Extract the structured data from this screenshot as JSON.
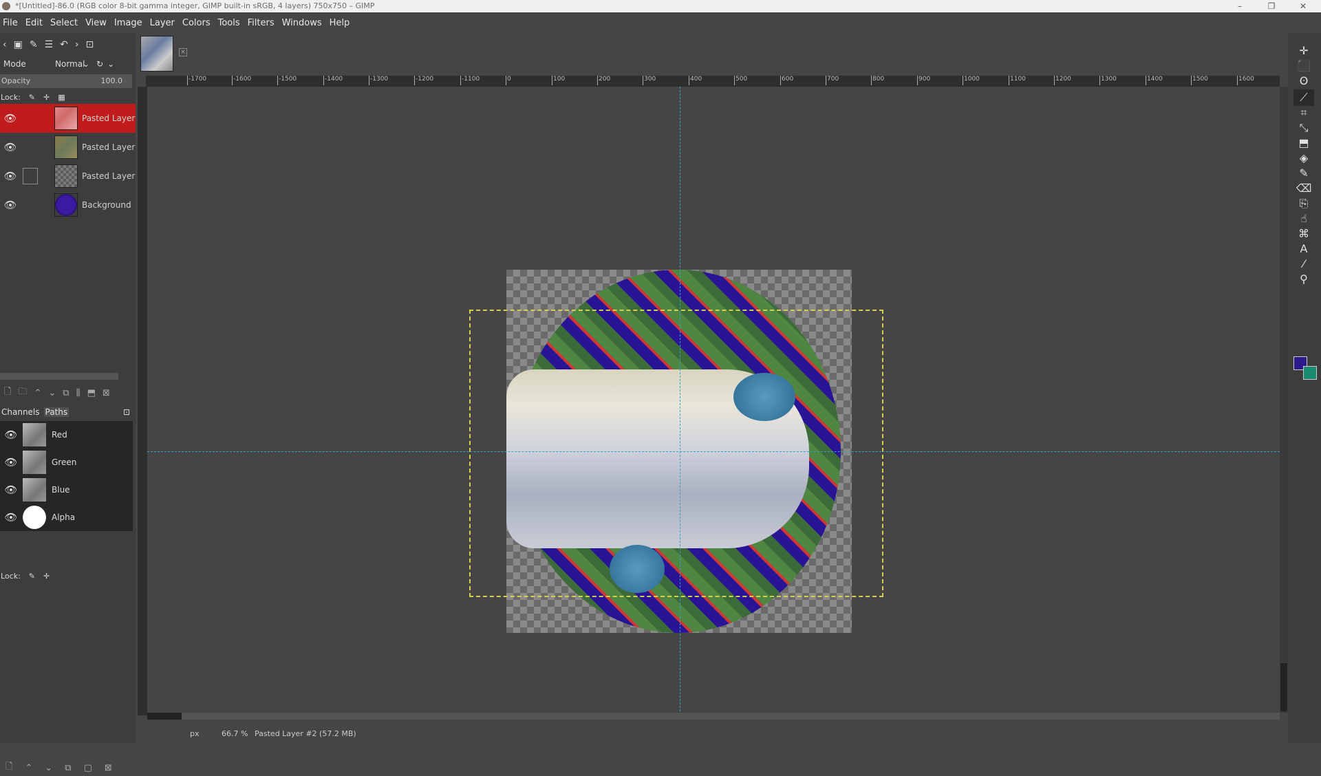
{
  "window": {
    "title": "*[Untitled]-86.0 (RGB color 8-bit gamma integer, GIMP built-in sRGB, 4 layers) 750x750 – GIMP",
    "minimize": "–",
    "maximize": "❐",
    "close": "✕"
  },
  "menu": [
    "File",
    "Edit",
    "Select",
    "View",
    "Image",
    "Layer",
    "Colors",
    "Tools",
    "Filters",
    "Windows",
    "Help"
  ],
  "layers_panel": {
    "mode_label": "Mode",
    "mode_value": "Normal",
    "opacity_label": "Opacity",
    "opacity_value": "100.0",
    "lock_label": "Lock:",
    "layers": [
      {
        "name": "Pasted Layer",
        "selected": true
      },
      {
        "name": "Pasted Layer",
        "selected": false
      },
      {
        "name": "Pasted Layer",
        "selected": false
      },
      {
        "name": "Background",
        "selected": false
      }
    ]
  },
  "channels_panel": {
    "tab_channels": "Channels",
    "tab_paths": "Paths",
    "lock_label": "Lock:",
    "channels": [
      {
        "name": "Red"
      },
      {
        "name": "Green"
      },
      {
        "name": "Blue"
      },
      {
        "name": "Alpha"
      }
    ]
  },
  "ruler": {
    "ticks": [
      "-1700",
      "-1600",
      "-1500",
      "-1400",
      "-1300",
      "-1200",
      "-1100",
      "0",
      "100",
      "200",
      "300",
      "400",
      "500",
      "600",
      "700",
      "800",
      "900",
      "1000",
      "1100",
      "1200",
      "1300",
      "1400",
      "1500",
      "1600"
    ]
  },
  "statusbar": {
    "unit": "px",
    "zoom": "66.7 %",
    "message": "Pasted Layer #2 (57.2 MB)"
  },
  "colors": {
    "selected_layer": "#c01c1c",
    "foreground": "#2a1a8a",
    "background": "#1a8a70",
    "guide": "#3aa0c8",
    "layer_boundary": "#d4d04a"
  }
}
